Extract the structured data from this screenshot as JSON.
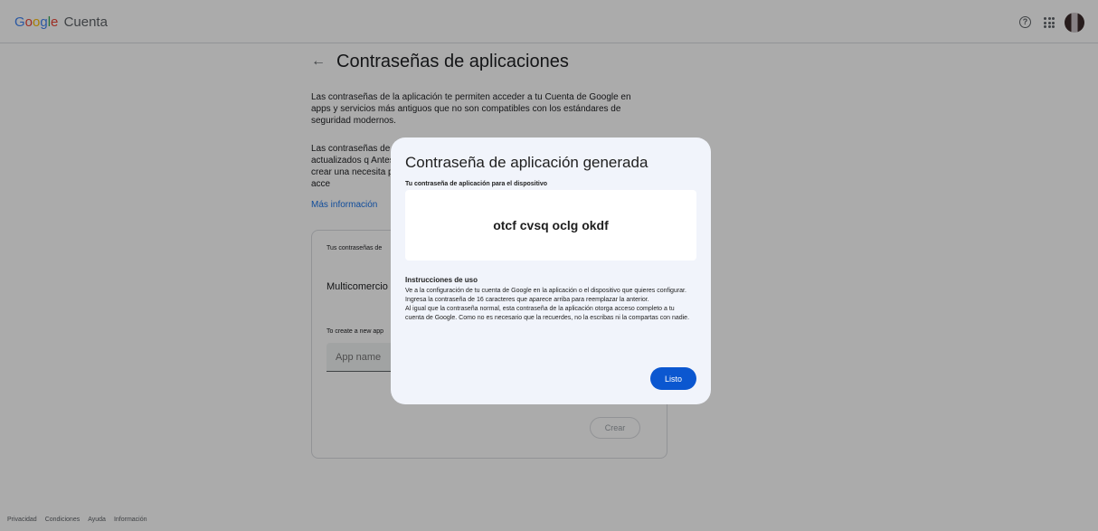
{
  "header": {
    "logo_letters": [
      "G",
      "o",
      "o",
      "g",
      "l",
      "e"
    ],
    "product": "Cuenta",
    "help_icon": "help-circle-icon",
    "apps_icon": "apps-grid-icon",
    "avatar": "user-avatar"
  },
  "page": {
    "title": "Contraseñas de aplicaciones",
    "para1": "Las contraseñas de la aplicación te permiten acceder a tu Cuenta de Google en apps y servicios más antiguos que no son compatibles con los estándares de seguridad modernos.",
    "para2": "Las contraseñas de cios actualizados q Antes de crear una necesita para acce",
    "more_link": "Más información"
  },
  "card": {
    "heading": "Tus contraseñas de",
    "app_entry": "Multicomercio",
    "create_hint": "To create a new app",
    "input_placeholder": "App name",
    "create_button": "Crear"
  },
  "footer": {
    "links": [
      "Privacidad",
      "Condiciones",
      "Ayuda",
      "Información"
    ]
  },
  "dialog": {
    "title": "Contraseña de aplicación generada",
    "subtitle": "Tu contraseña de aplicación para el dispositivo",
    "password": "otcf cvsq oclg okdf",
    "instructions_title": "Instrucciones de uso",
    "instructions_p1": "Ve a la configuración de tu cuenta de Google en la aplicación o el dispositivo que quieres configurar. Ingresa la contraseña de 16 caracteres que aparece arriba para reemplazar la anterior.",
    "instructions_p2": "Al igual que la contraseña normal, esta contraseña de la aplicación otorga acceso completo a tu cuenta de Google. Como no es necesario que la recuerdes, no la escribas ni la compartas con nadie.",
    "done_button": "Listo"
  }
}
